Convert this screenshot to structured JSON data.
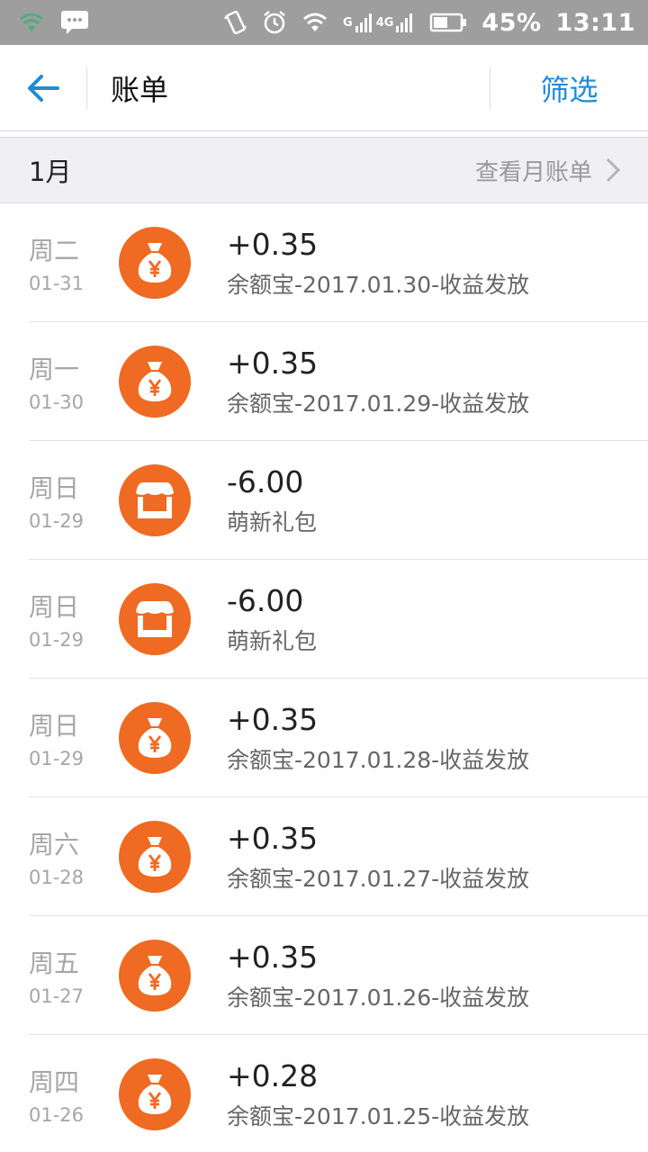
{
  "status_bar": {
    "battery": "45%",
    "time": "13:11",
    "network_label": "4G",
    "signal_label": "G"
  },
  "header": {
    "title": "账单",
    "filter_label": "筛选"
  },
  "month": {
    "label": "1月",
    "link_label": "查看月账单"
  },
  "colors": {
    "accent_blue": "#1e8bdb",
    "icon_orange": "#ef6a22"
  },
  "transactions": [
    {
      "weekday": "周二",
      "date": "01-31",
      "amount": "+0.35",
      "desc": "余额宝-2017.01.30-收益发放",
      "icon": "money-bag-icon"
    },
    {
      "weekday": "周一",
      "date": "01-30",
      "amount": "+0.35",
      "desc": "余额宝-2017.01.29-收益发放",
      "icon": "money-bag-icon"
    },
    {
      "weekday": "周日",
      "date": "01-29",
      "amount": "-6.00",
      "desc": "萌新礼包",
      "icon": "shop-icon"
    },
    {
      "weekday": "周日",
      "date": "01-29",
      "amount": "-6.00",
      "desc": "萌新礼包",
      "icon": "shop-icon"
    },
    {
      "weekday": "周日",
      "date": "01-29",
      "amount": "+0.35",
      "desc": "余额宝-2017.01.28-收益发放",
      "icon": "money-bag-icon"
    },
    {
      "weekday": "周六",
      "date": "01-28",
      "amount": "+0.35",
      "desc": "余额宝-2017.01.27-收益发放",
      "icon": "money-bag-icon"
    },
    {
      "weekday": "周五",
      "date": "01-27",
      "amount": "+0.35",
      "desc": "余额宝-2017.01.26-收益发放",
      "icon": "money-bag-icon"
    },
    {
      "weekday": "周四",
      "date": "01-26",
      "amount": "+0.28",
      "desc": "余额宝-2017.01.25-收益发放",
      "icon": "money-bag-icon"
    }
  ]
}
